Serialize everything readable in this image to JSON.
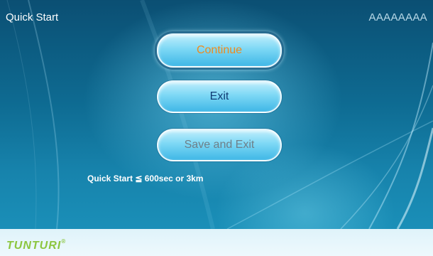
{
  "header": {
    "title": "Quick Start",
    "device_id": "AAAAAAAA"
  },
  "menu": {
    "continue_label": "Continue",
    "exit_label": "Exit",
    "save_exit_label": "Save and Exit"
  },
  "info": {
    "limit_note": "Quick Start ≦ 600sec or 3km"
  },
  "footer": {
    "brand": "TUNTURI",
    "trademark": "®"
  },
  "colors": {
    "accent_continue": "#f08a1c",
    "exit_text": "#103c74",
    "save_exit_text": "#6e7f88",
    "brand_green": "#8cc63f"
  }
}
